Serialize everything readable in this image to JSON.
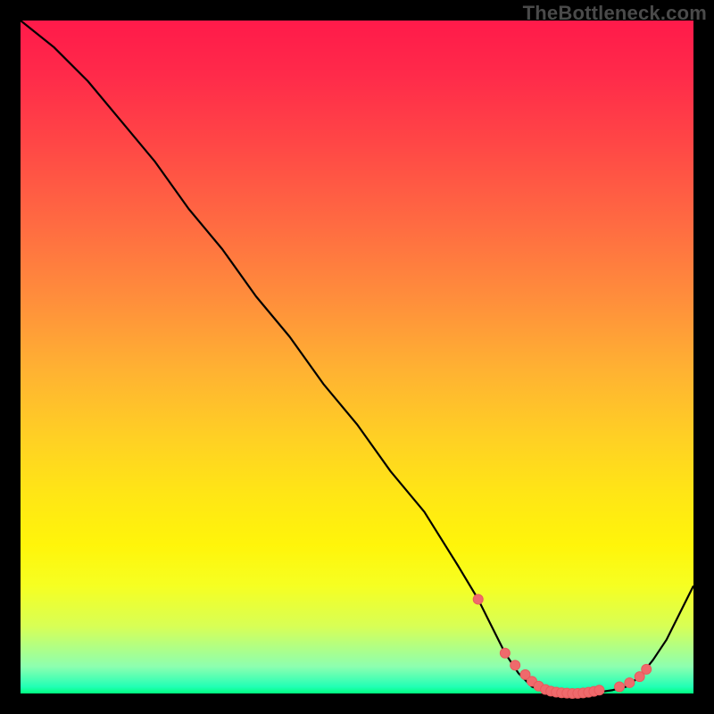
{
  "watermark": "TheBottleneck.com",
  "colors": {
    "page_bg": "#000000",
    "curve": "#000000",
    "marker_fill": "#ef6a6c",
    "marker_stroke": "#e85b5d"
  },
  "chart_data": {
    "type": "line",
    "title": "",
    "xlabel": "",
    "ylabel": "",
    "xlim": [
      0,
      100
    ],
    "ylim": [
      0,
      100
    ],
    "grid": false,
    "legend": false,
    "series": [
      {
        "name": "curve",
        "x": [
          0,
          5,
          10,
          15,
          20,
          25,
          30,
          35,
          40,
          45,
          50,
          55,
          60,
          65,
          68,
          70,
          72,
          74,
          76,
          78,
          80,
          82,
          84,
          86,
          88,
          90,
          92,
          94,
          96,
          98,
          100
        ],
        "y": [
          100,
          96,
          91,
          85,
          79,
          72,
          66,
          59,
          53,
          46,
          40,
          33,
          27,
          19,
          14,
          10,
          6,
          3,
          1,
          0.3,
          0,
          0,
          0,
          0.2,
          0.5,
          1,
          2.5,
          5,
          8,
          12,
          16
        ]
      }
    ],
    "markers": {
      "name": "highlight-points",
      "x": [
        68,
        72,
        73.5,
        75,
        76,
        77,
        78,
        78.8,
        79.6,
        80.4,
        81.2,
        82,
        82.8,
        83.6,
        84.4,
        85.2,
        86,
        89,
        90.5,
        92,
        93
      ],
      "y": [
        14,
        6,
        4.2,
        2.8,
        1.8,
        1.1,
        0.6,
        0.35,
        0.2,
        0.1,
        0.05,
        0,
        0.02,
        0.08,
        0.18,
        0.32,
        0.5,
        1,
        1.6,
        2.5,
        3.6
      ]
    }
  }
}
